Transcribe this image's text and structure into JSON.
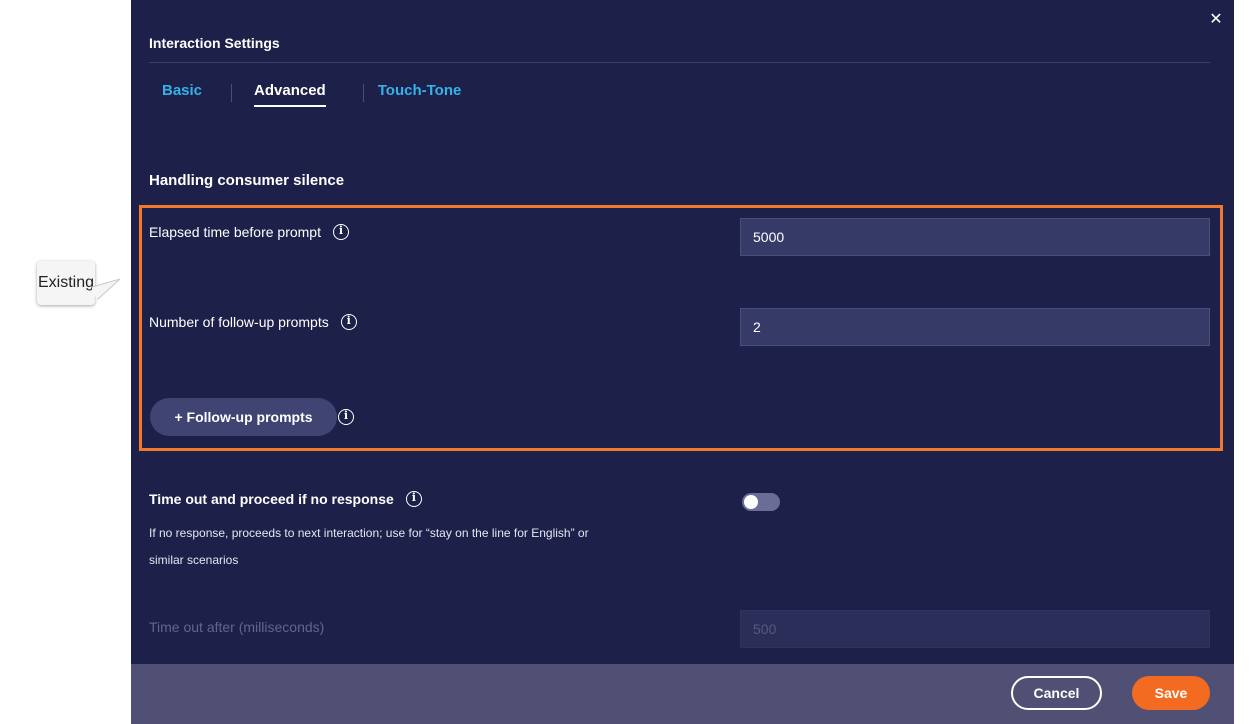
{
  "callout": {
    "text": "Existing"
  },
  "dialog": {
    "title": "Interaction Settings",
    "close_icon": "close-icon",
    "tabs": [
      {
        "label": "Basic",
        "active": false
      },
      {
        "label": "Advanced",
        "active": true
      },
      {
        "label": "Touch-Tone",
        "active": false
      }
    ]
  },
  "silence": {
    "section_title": "Handling consumer silence",
    "elapsed_label": "Elapsed time before prompt",
    "elapsed_value": "5000",
    "followup_count_label": "Number of follow-up prompts",
    "followup_count_value": "2",
    "followup_button": "+ Follow-up prompts"
  },
  "timeout": {
    "label": "Time out and proceed if no response",
    "description_line1": "If no response, proceeds to next interaction; use for “stay on the line for English” or",
    "description_line2": "similar scenarios",
    "toggle_on": false,
    "after_label": "Time out after (milliseconds)",
    "after_placeholder": "500"
  },
  "footer": {
    "cancel_label": "Cancel",
    "save_label": "Save"
  },
  "colors": {
    "modal_bg": "#1d2049",
    "accent_tab": "#35b2e8",
    "highlight": "#f07a2a",
    "save_button": "#f36a21",
    "footer_bg": "#505074"
  }
}
